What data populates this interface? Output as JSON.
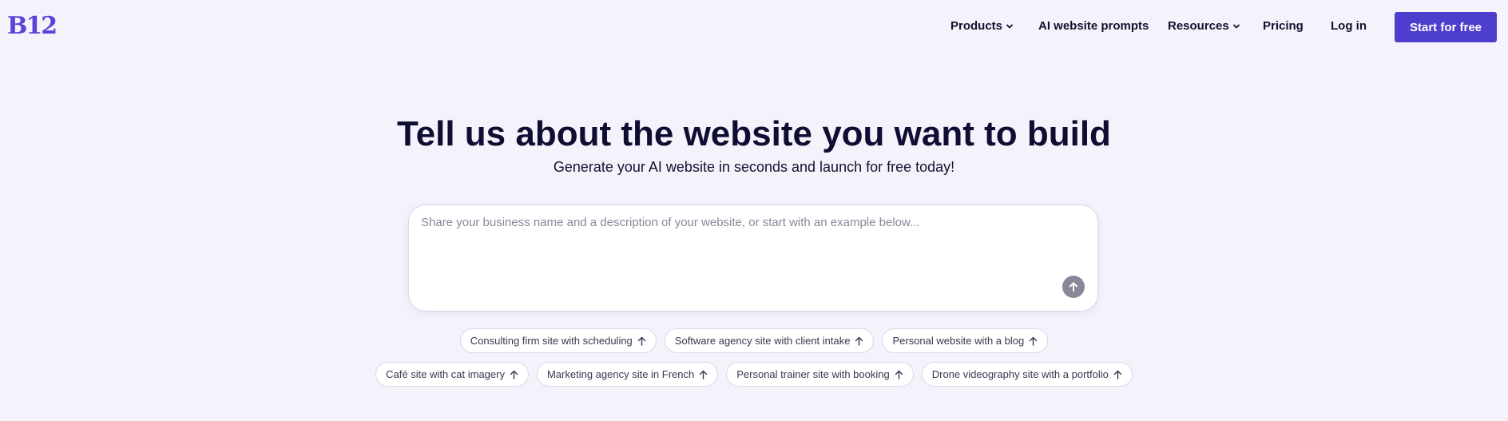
{
  "header": {
    "logo": "B12",
    "nav": [
      {
        "label": "Products",
        "has_dropdown": true
      },
      {
        "label": "AI website prompts",
        "has_dropdown": false
      },
      {
        "label": "Resources",
        "has_dropdown": true
      },
      {
        "label": "Pricing",
        "has_dropdown": false
      },
      {
        "label": "Log in",
        "has_dropdown": false
      }
    ],
    "cta_label": "Start for free"
  },
  "hero": {
    "title": "Tell us about the website you want to build",
    "subtitle": "Generate your AI website in seconds and launch for free today!"
  },
  "prompt": {
    "placeholder": "Share your business name and a description of your website, or start with an example below...",
    "value": "",
    "submit_icon": "arrow-up-icon"
  },
  "examples": {
    "row1": [
      "Consulting firm site with scheduling",
      "Software agency site with client intake",
      "Personal website with a blog"
    ],
    "row2": [
      "Café site with cat imagery",
      "Marketing agency site in French",
      "Personal trainer site with booking",
      "Drone videography site with a portfolio"
    ]
  },
  "colors": {
    "background": "#f4f3fc",
    "brand": "#5a43d6",
    "cta": "#4e3ecd",
    "submit_disabled": "#8a8799"
  }
}
